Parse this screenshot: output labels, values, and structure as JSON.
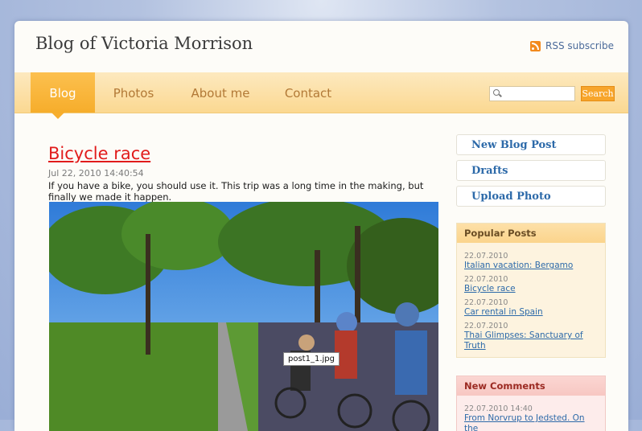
{
  "header": {
    "title": "Blog of Victoria Morrison",
    "rss_label": "RSS subscribe"
  },
  "nav": {
    "items": [
      {
        "label": "Blog",
        "active": true
      },
      {
        "label": "Photos",
        "active": false
      },
      {
        "label": "About me",
        "active": false
      },
      {
        "label": "Contact",
        "active": false
      }
    ],
    "search": {
      "placeholder": "",
      "button_label": "Search"
    }
  },
  "post": {
    "title": "Bicycle race",
    "date": "Jul 22, 2010 14:40:54",
    "text": "If you have a bike, you should use it. This trip was a long time in the making, but finally we made it happen.",
    "image_tooltip": "post1_1.jpg"
  },
  "sidebar": {
    "links": [
      "New Blog Post",
      "Drafts",
      "Upload Photo"
    ],
    "popular": {
      "title": "Popular Posts",
      "items": [
        {
          "date": "22.07.2010",
          "title": "Italian vacation: Bergamo"
        },
        {
          "date": "22.07.2010",
          "title": "Bicycle race"
        },
        {
          "date": "22.07.2010",
          "title": "Car rental in Spain"
        },
        {
          "date": "22.07.2010",
          "title": "Thai Glimpses: Sanctuary of Truth"
        }
      ]
    },
    "comments": {
      "title": "New Comments",
      "items": [
        {
          "date": "22.07.2010 14:40",
          "title": "From Norvrup to Jedsted. On the"
        }
      ]
    }
  },
  "colors": {
    "accent": "#f7a52b",
    "link": "#2d6aa9",
    "post_title": "#e11b1b"
  }
}
